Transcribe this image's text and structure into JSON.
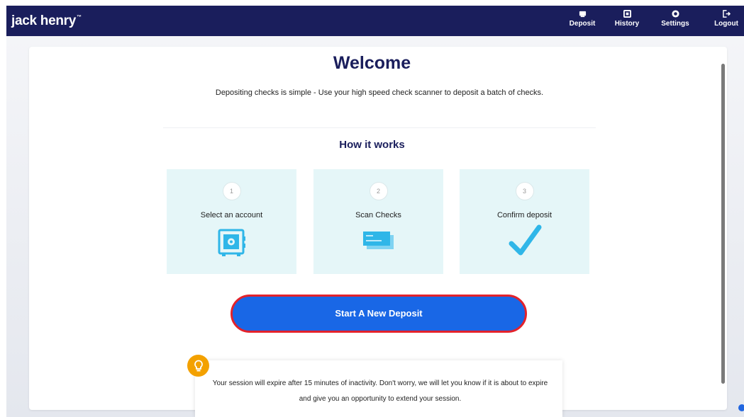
{
  "header": {
    "brand": "jack henry",
    "brand_mark": "™",
    "nav": [
      {
        "label": "Deposit",
        "icon": "deposit-icon"
      },
      {
        "label": "History",
        "icon": "history-icon"
      },
      {
        "label": "Settings",
        "icon": "gear-icon"
      },
      {
        "label": "Logout",
        "icon": "logout-icon"
      }
    ]
  },
  "main": {
    "title": "Welcome",
    "intro": "Depositing checks is simple - Use your high speed check scanner to deposit a batch of checks.",
    "how_title": "How it works",
    "steps": [
      {
        "number": "1",
        "label": "Select an account",
        "icon": "safe-icon"
      },
      {
        "number": "2",
        "label": "Scan Checks",
        "icon": "checks-icon"
      },
      {
        "number": "3",
        "label": "Confirm deposit",
        "icon": "checkmark-icon"
      }
    ],
    "cta_label": "Start A New Deposit",
    "session_notice": "Your session will expire after 15 minutes of inactivity. Don't worry, we will let you know if it is about to expire and give you an opportunity to extend your session."
  },
  "colors": {
    "header_bg": "#1a1e5c",
    "primary_button": "#1967e6",
    "button_outline": "#e3222b",
    "step_bg": "#e5f6f8",
    "step_icon": "#2fb6e8",
    "hint_icon_bg": "#f3a100"
  }
}
